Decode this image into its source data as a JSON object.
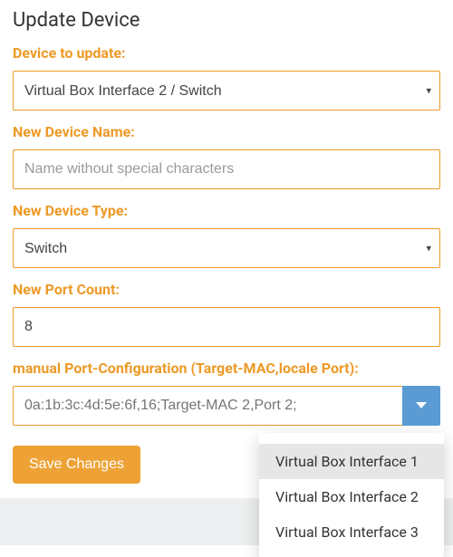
{
  "colors": {
    "accent": "#ed9a27",
    "combo_button": "#5a9bd4"
  },
  "title": "Update Device",
  "device_to_update": {
    "label": "Device to update:",
    "selected": "Virtual Box Interface 2 / Switch"
  },
  "new_device_name": {
    "label": "New Device Name:",
    "value": "",
    "placeholder": "Name without special characters"
  },
  "new_device_type": {
    "label": "New Device Type:",
    "selected": "Switch"
  },
  "new_port_count": {
    "label": "New Port Count:",
    "value": "8"
  },
  "port_config": {
    "label": "manual Port-Configuration (Target-MAC,locale Port):",
    "placeholder": "0a:1b:3c:4d:5e:6f,16;Target-MAC 2,Port 2;",
    "value": ""
  },
  "save_label": "Save Changes",
  "dropdown": {
    "items": [
      {
        "label": "Virtual Box Interface 1",
        "active": true
      },
      {
        "label": "Virtual Box Interface 2",
        "active": false
      },
      {
        "label": "Virtual Box Interface 3",
        "active": false
      }
    ]
  }
}
